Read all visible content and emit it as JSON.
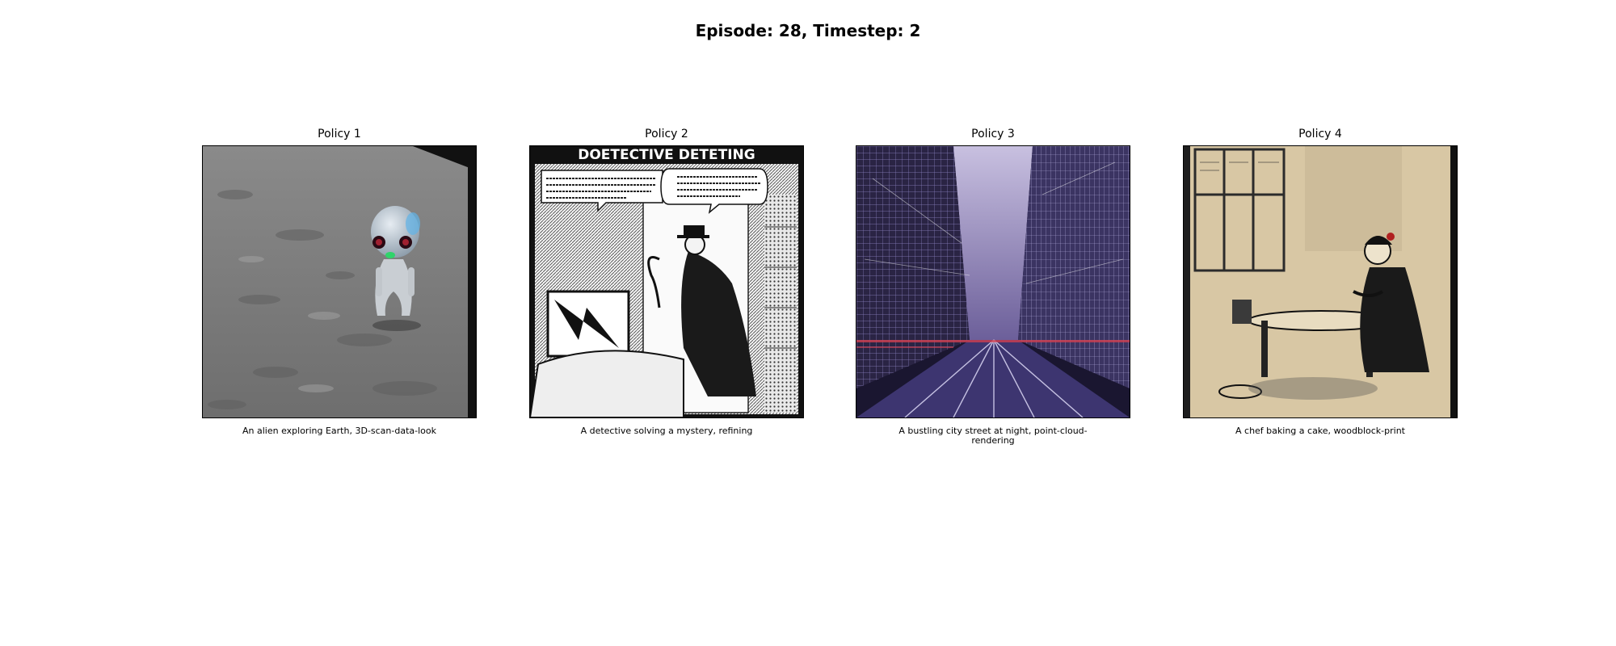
{
  "figure": {
    "title": "Episode: 28, Timestep: 2"
  },
  "panels": [
    {
      "title": "Policy 1",
      "caption": "An alien exploring Earth, 3D-scan-data-look",
      "image_subject": "alien standing on grey cratered terrain"
    },
    {
      "title": "Policy 2",
      "caption": "A detective solving a mystery, refining",
      "image_subject": "black and white comic panel of a detective in a top hat",
      "image_text": {
        "banner": "DOETECTIVE DETETING"
      }
    },
    {
      "title": "Policy 3",
      "caption": "A bustling city street at night, point-cloud-rendering",
      "image_subject": "purple wireframe city street with tall buildings"
    },
    {
      "title": "Policy 4",
      "caption": "A chef baking a cake, woodblock-print",
      "image_subject": "woodblock print of a woman preparing food at a table"
    }
  ]
}
